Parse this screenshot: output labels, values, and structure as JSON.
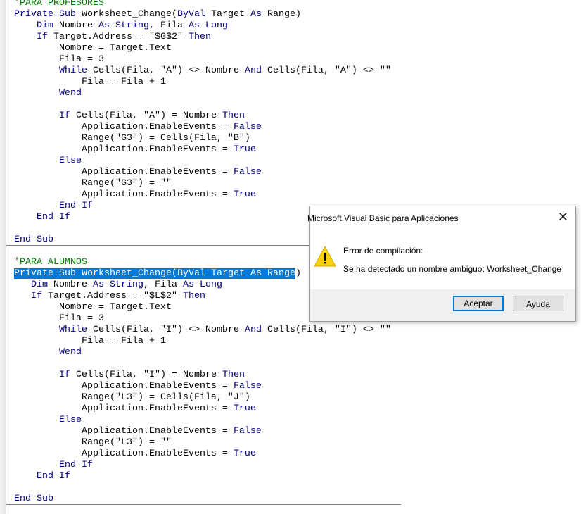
{
  "editor": {
    "lines": [
      "'PARA PROFESORES",
      "Private Sub Worksheet_Change(ByVal Target As Range)",
      "    Dim Nombre As String, Fila As Long",
      "    If Target.Address = \"$G$2\" Then",
      "        Nombre = Target.Text",
      "        Fila = 3",
      "        While Cells(Fila, \"A\") <> Nombre And Cells(Fila, \"A\") <> \"\"",
      "            Fila = Fila + 1",
      "        Wend",
      "",
      "        If Cells(Fila, \"A\") = Nombre Then",
      "            Application.EnableEvents = False",
      "            Range(\"G3\") = Cells(Fila, \"B\")",
      "            Application.EnableEvents = True",
      "        Else",
      "            Application.EnableEvents = False",
      "            Range(\"G3\") = \"\"",
      "            Application.EnableEvents = True",
      "        End If",
      "    End If",
      "",
      "End Sub",
      "",
      "'PARA ALUMNOS",
      "Private Sub Worksheet_Change(ByVal Target As Range)",
      "   Dim Nombre As String, Fila As Long",
      "   If Target.Address = \"$L$2\" Then",
      "        Nombre = Target.Text",
      "        Fila = 3",
      "        While Cells(Fila, \"I\") <> Nombre And Cells(Fila, \"I\") <> \"\"",
      "            Fila = Fila + 1",
      "        Wend",
      "",
      "        If Cells(Fila, \"I\") = Nombre Then",
      "            Application.EnableEvents = False",
      "            Range(\"L3\") = Cells(Fila, \"J\")",
      "            Application.EnableEvents = True",
      "        Else",
      "            Application.EnableEvents = False",
      "            Range(\"L3\") = \"\"",
      "            Application.EnableEvents = True",
      "        End If",
      "    End If",
      "",
      "End Sub"
    ],
    "keyword_color": "#00007f",
    "comment_color": "#008000",
    "selection_color": "#0078d7"
  },
  "dialog": {
    "title": "Microsoft Visual Basic para Aplicaciones",
    "close_icon": "close-icon",
    "icon": "warning-icon",
    "heading": "Error de compilación:",
    "message": "Se ha detectado un nombre ambiguo: Worksheet_Change",
    "ok_label": "Aceptar",
    "help_label": "Ayuda"
  }
}
